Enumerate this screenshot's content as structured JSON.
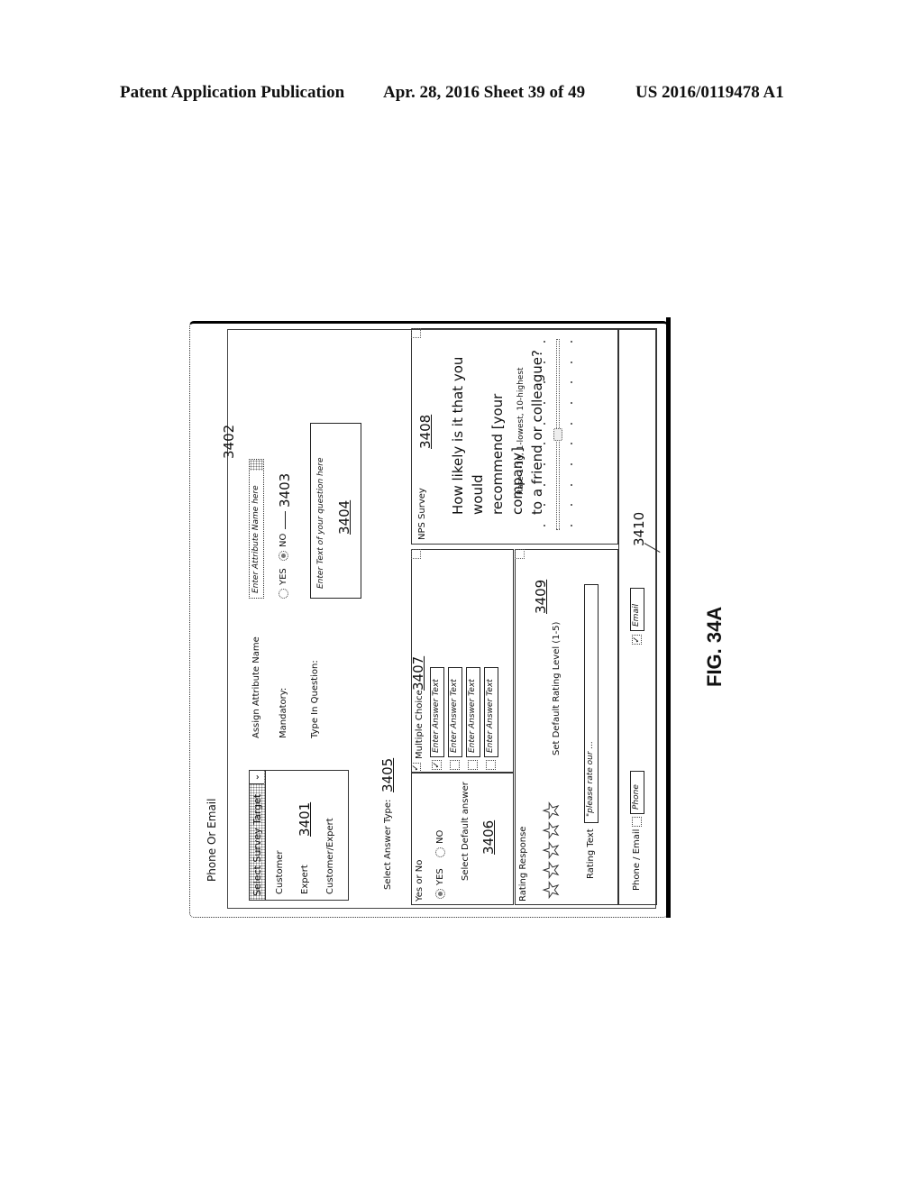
{
  "header": {
    "left": "Patent Application Publication",
    "middle": "Apr. 28, 2016  Sheet 39 of 49",
    "right": "US 2016/0119478 A1"
  },
  "figure_label": "FIG. 34A",
  "window": {
    "title": "Phone Or Email"
  },
  "survey_target": {
    "label": "Select Survey Target",
    "options": [
      "Customer",
      "Expert",
      "Customer/Expert"
    ],
    "ref": "3401",
    "icon": "chevron-down-icon"
  },
  "attribute": {
    "label": "Assign Attribute Name",
    "placeholder": "Enter Attribute Name here",
    "ref": "3402"
  },
  "mandatory": {
    "label": "Mandatory:",
    "options": [
      "YES",
      "NO"
    ],
    "selected": "NO",
    "ref": "3403"
  },
  "question": {
    "label": "Type In Question:",
    "placeholder": "Enter Text of your question here",
    "ref": "3404"
  },
  "answer_type": {
    "label": "Select Answer Type:",
    "ref": "3405"
  },
  "yes_no": {
    "title": "Yes or No",
    "options": [
      "YES",
      "NO"
    ],
    "selected": "YES",
    "default_label": "Select Default answer",
    "ref": "3406"
  },
  "multiple_choice": {
    "title": "Multiple Choice",
    "checked": true,
    "ref": "3407",
    "answers": [
      {
        "placeholder": "Enter Answer Text",
        "checked": true
      },
      {
        "placeholder": "Enter Answer Text",
        "checked": false
      },
      {
        "placeholder": "Enter Answer Text",
        "checked": false
      },
      {
        "placeholder": "Enter Answer Text",
        "checked": false
      }
    ]
  },
  "nps": {
    "title": "NPS Survey",
    "ref": "3408",
    "question_lines": [
      "How likely is it that you would",
      "recommend [your company]",
      "to a friend or colleague?"
    ],
    "scale_label": "Rate 1-10, 1-lowest, 10-highest",
    "scale_min": 1,
    "scale_max": 10,
    "value": 5.5
  },
  "rating": {
    "title": "Rating Response",
    "ref": "3409",
    "stars": 5,
    "default_label": "Set Default Rating Level (1-5)",
    "text_label": "Rating Text",
    "text_value": "\"please rate our ..."
  },
  "contact": {
    "label": "Phone  /  Email",
    "ref": "3410",
    "phone_label": "Phone",
    "phone_checked": false,
    "email_label": "Email",
    "email_checked": true
  }
}
